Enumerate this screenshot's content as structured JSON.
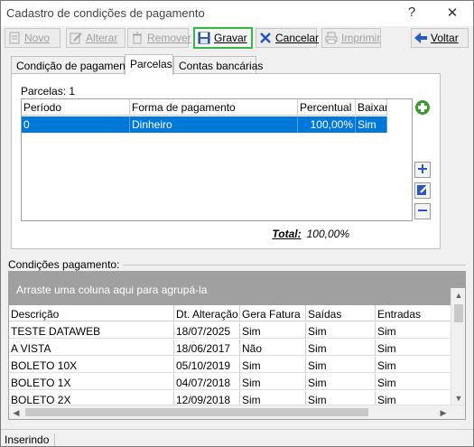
{
  "window": {
    "title": "Cadastro de condições de pagamento",
    "help_glyph": "?",
    "close_glyph": "✕"
  },
  "toolbar": {
    "novo": "Novo",
    "alterar": "Alterar",
    "remover": "Remover",
    "gravar": "Gravar",
    "cancelar": "Cancelar",
    "imprimir": "Imprimir",
    "voltar": "Voltar"
  },
  "tabs": [
    "Condição de pagamento",
    "Parcelas",
    "Contas bancárias"
  ],
  "parcelas": {
    "count_label": "Parcelas: 1",
    "columns": [
      "Período",
      "Forma de pagamento",
      "Percentual",
      "Baixar"
    ],
    "rows": [
      {
        "periodo": "0",
        "forma": "Dinheiro",
        "percentual": "100,00%",
        "baixar": "Sim"
      }
    ],
    "total_label": "Total:",
    "total_value": "100,00%"
  },
  "condicoes": {
    "section_label": "Condições pagamento:",
    "group_hint": "Arraste uma coluna aqui para agrupá-la",
    "columns": [
      "Descrição",
      "Dt. Alteração",
      "Gera Fatura",
      "Saídas",
      "Entradas"
    ],
    "rows": [
      [
        "TESTE DATAWEB",
        "18/07/2025",
        "Sim",
        "Sim",
        "Sim"
      ],
      [
        "A VISTA",
        "18/06/2017",
        "Não",
        "Sim",
        "Sim"
      ],
      [
        "BOLETO 10X",
        "05/10/2019",
        "Sim",
        "Sim",
        "Sim"
      ],
      [
        "BOLETO 1X",
        "04/07/2018",
        "Sim",
        "Sim",
        "Sim"
      ],
      [
        "BOLETO 2X",
        "12/09/2018",
        "Sim",
        "Sim",
        "Sim"
      ]
    ]
  },
  "status": {
    "mode": "Inserindo"
  },
  "colors": {
    "selection": "#0078d7",
    "gravar_outline": "#3bb44a",
    "group_area": "#a0a0a0",
    "add_green": "#3a9a2a"
  }
}
